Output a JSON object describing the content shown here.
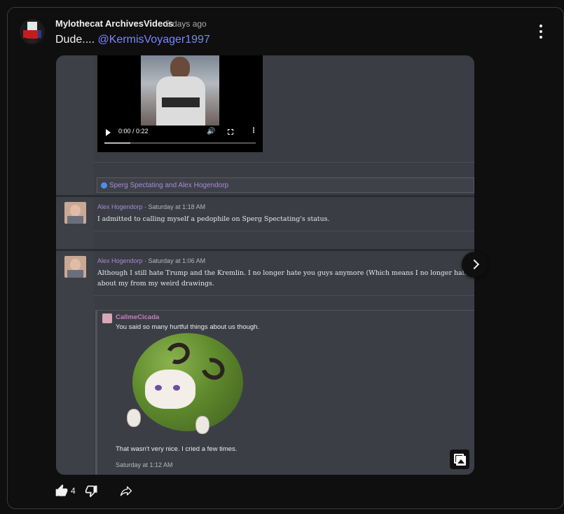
{
  "post": {
    "author": "Mylothecat ArchivesVideos",
    "time": "5 days ago",
    "text": "Dude....",
    "mention": "@KermisVoyager1997"
  },
  "embedded_image": {
    "video": {
      "time": "0:00 / 0:22",
      "progress": 0.17
    },
    "tag_line": "Sperg Spectating and Alex Hogendorp",
    "comments": [
      {
        "name": "Alex Hogendorp",
        "date": " · Saturday at 1:18 AM",
        "lines": [
          "I admitted to calling myself a pedophile on Sperg Spectating's status."
        ]
      },
      {
        "name": "Alex Hogendorp",
        "date": " · Saturday at 1:06 AM",
        "lines": [
          "Although I still hate Trump and the Kremlin. I no longer hate you guys anymore (Which means I no longer hate A",
          "about my from my weird drawings."
        ]
      }
    ],
    "quote": {
      "name": "CallmeCicada",
      "line1": "You said so many hurtful things about us though.",
      "line2": "That wasn't very nice. I cried a few times.",
      "date": "Saturday at 1:12 AM"
    }
  },
  "actions": {
    "like_count": "4"
  },
  "icons": {
    "menu": "more-vert-icon",
    "like": "thumb-up-icon",
    "dislike": "thumb-down-icon",
    "share": "share-icon",
    "next": "chevron-right-icon",
    "gallery": "gallery-icon"
  },
  "colors": {
    "background": "#0f0f0f",
    "mention": "#7a86ff",
    "forum_name": "#a58bd8",
    "quote_name": "#c87fbd"
  }
}
